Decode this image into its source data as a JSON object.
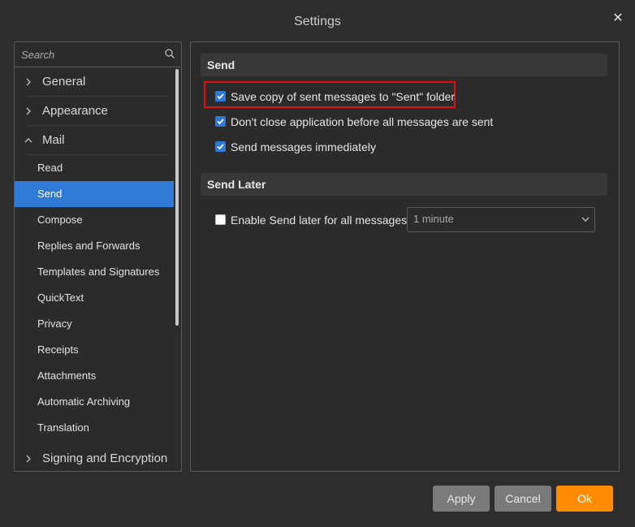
{
  "window": {
    "title": "Settings",
    "close_symbol": "✕"
  },
  "search": {
    "placeholder": "Search"
  },
  "nav": {
    "general": "General",
    "appearance": "Appearance",
    "mail": "Mail",
    "mail_children": [
      "Read",
      "Send",
      "Compose",
      "Replies and Forwards",
      "Templates and Signatures",
      "QuickText",
      "Privacy",
      "Receipts",
      "Attachments",
      "Automatic Archiving",
      "Translation"
    ],
    "signing": "Signing and Encryption",
    "selected": "Send"
  },
  "send_section": {
    "header": "Send",
    "options": [
      {
        "label": "Save copy of sent messages to \"Sent\" folder",
        "checked": true
      },
      {
        "label": "Don't close application before all messages are sent",
        "checked": true
      },
      {
        "label": "Send messages immediately",
        "checked": true
      }
    ]
  },
  "send_later_section": {
    "header": "Send Later",
    "enable_label": "Enable Send later for all messages",
    "enable_checked": false,
    "delay_value": "1 minute"
  },
  "buttons": {
    "apply": "Apply",
    "cancel": "Cancel",
    "ok": "Ok"
  },
  "colors": {
    "accent": "#2f7ad6",
    "ok": "#ff8c00",
    "highlight": "#e01010",
    "background": "#2d2d2d"
  }
}
